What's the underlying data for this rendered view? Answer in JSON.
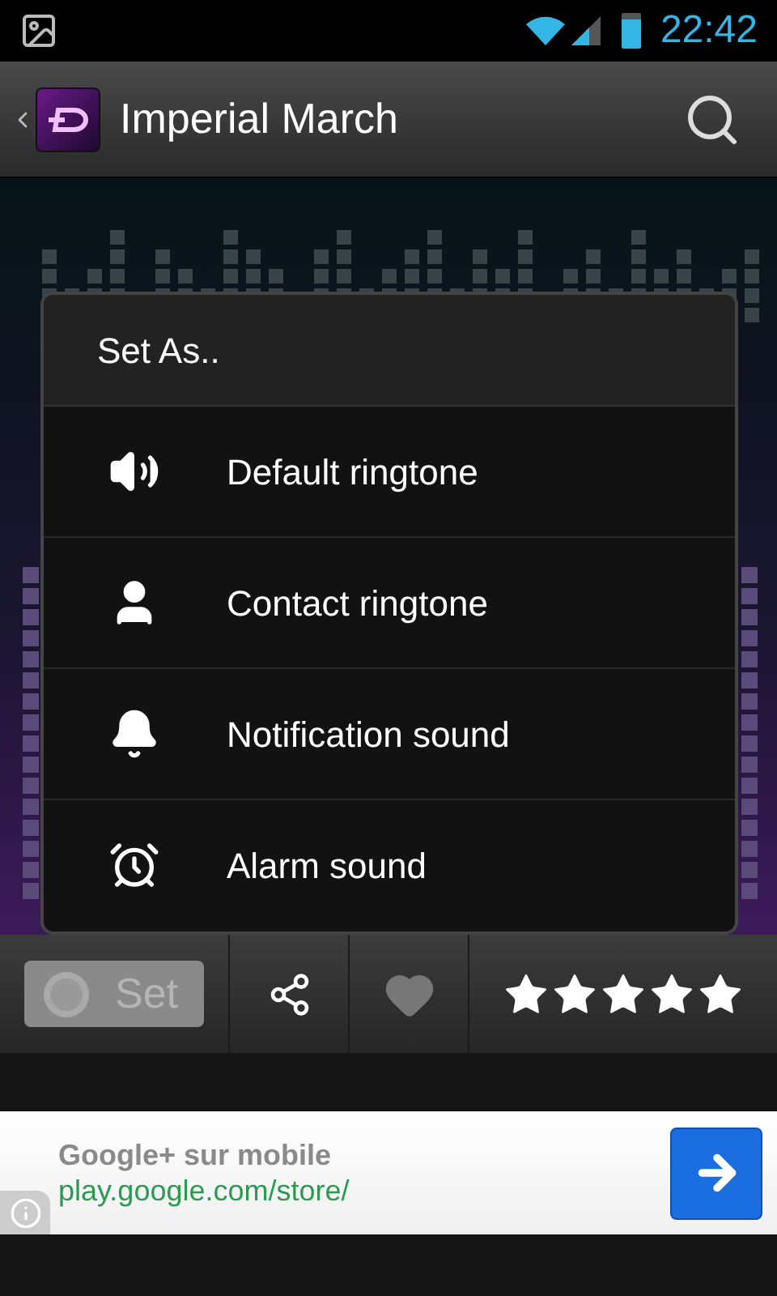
{
  "status_bar": {
    "time": "22:42"
  },
  "action_bar": {
    "title": "Imperial March"
  },
  "dialog": {
    "title": "Set As..",
    "items": [
      {
        "kind": "speaker",
        "label": "Default ringtone"
      },
      {
        "kind": "person",
        "label": "Contact ringtone"
      },
      {
        "kind": "bell",
        "label": "Notification sound"
      },
      {
        "kind": "alarm",
        "label": "Alarm sound"
      }
    ]
  },
  "toolbar": {
    "set_button": {
      "label": "Set",
      "disabled": true
    },
    "favorite": false,
    "stars": 5
  },
  "ad": {
    "title": "Google+ sur mobile",
    "url": "play.google.com/store/"
  }
}
